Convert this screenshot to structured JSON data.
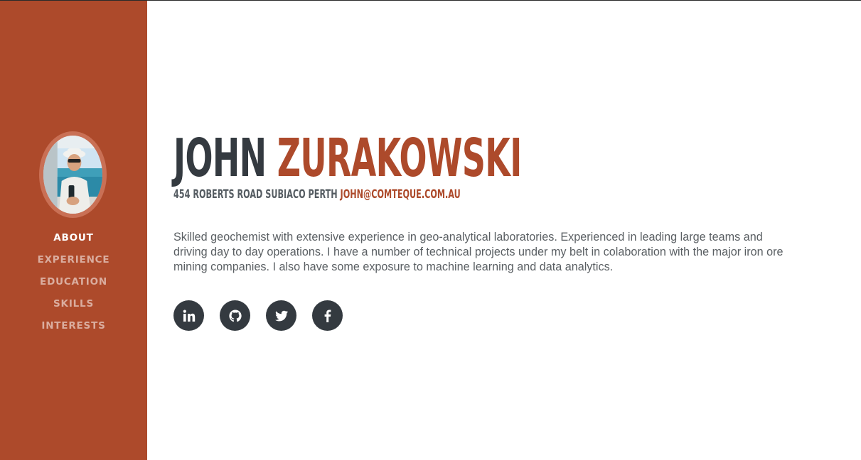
{
  "profile": {
    "first_name": "JOHN",
    "last_name": "ZURAKOWSKI",
    "address": "454 ROBERTS ROAD SUBIACO PERTH",
    "email": "JOHN@COMTEQUE.COM.AU",
    "bio": "Skilled geochemist with extensive experience in geo-analytical laboratories. Experienced in leading large teams and driving day to day operations. I have a number of technical projects under my belt in colaboration with the major iron ore mining companies. I also have some exposure to machine learning and data analytics."
  },
  "nav": {
    "items": [
      {
        "label": "ABOUT",
        "active": true
      },
      {
        "label": "EXPERIENCE",
        "active": false
      },
      {
        "label": "EDUCATION",
        "active": false
      },
      {
        "label": "SKILLS",
        "active": false
      },
      {
        "label": "INTERESTS",
        "active": false
      }
    ]
  },
  "social": [
    {
      "icon": "linkedin-icon"
    },
    {
      "icon": "github-icon"
    },
    {
      "icon": "twitter-icon"
    },
    {
      "icon": "facebook-icon"
    }
  ],
  "colors": {
    "primary": "#ad4a2b",
    "dark": "#343a40",
    "text": "#5a5f63"
  }
}
